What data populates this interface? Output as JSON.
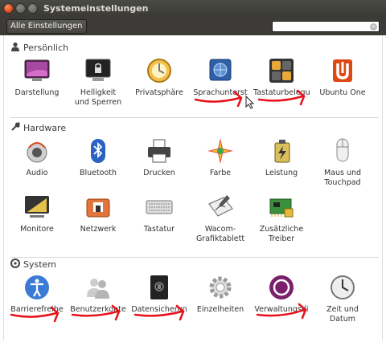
{
  "window": {
    "title": "Systemeinstellungen"
  },
  "toolbar": {
    "all_settings_label": "Alle Einstellungen",
    "search_value": "",
    "search_placeholder": ""
  },
  "sections": {
    "personal": {
      "title": "Persönlich",
      "items": [
        {
          "label": "Darstellung",
          "icon": "appearance-icon"
        },
        {
          "label": "Helligkeit\nund Sperren",
          "icon": "brightness-lock-icon"
        },
        {
          "label": "Privatsphäre",
          "icon": "privacy-icon"
        },
        {
          "label": "Sprachunterst",
          "icon": "language-support-icon"
        },
        {
          "label": "Tastaturbelegu",
          "icon": "keyboard-layout-icon"
        },
        {
          "label": "Ubuntu One",
          "icon": "ubuntu-one-icon"
        }
      ]
    },
    "hardware": {
      "title": "Hardware",
      "items": [
        {
          "label": "Audio",
          "icon": "audio-icon"
        },
        {
          "label": "Bluetooth",
          "icon": "bluetooth-icon"
        },
        {
          "label": "Drucken",
          "icon": "printer-icon"
        },
        {
          "label": "Farbe",
          "icon": "color-icon"
        },
        {
          "label": "Leistung",
          "icon": "power-icon"
        },
        {
          "label": "Maus und\nTouchpad",
          "icon": "mouse-icon"
        },
        {
          "label": "Monitore",
          "icon": "displays-icon"
        },
        {
          "label": "Netzwerk",
          "icon": "network-icon"
        },
        {
          "label": "Tastatur",
          "icon": "keyboard-icon"
        },
        {
          "label": "Wacom-\nGrafiktablett",
          "icon": "wacom-tablet-icon"
        },
        {
          "label": "Zusätzliche\nTreiber",
          "icon": "additional-drivers-icon"
        }
      ]
    },
    "system": {
      "title": "System",
      "items": [
        {
          "label": "Barrierefreihe",
          "icon": "accessibility-icon"
        },
        {
          "label": "Benutzerkonte",
          "icon": "user-accounts-icon"
        },
        {
          "label": "Datensicherun",
          "icon": "backup-icon"
        },
        {
          "label": "Einzelheiten",
          "icon": "details-icon"
        },
        {
          "label": "Verwaltungsdi",
          "icon": "management-service-icon"
        },
        {
          "label": "Zeit und\nDatum",
          "icon": "time-date-icon"
        }
      ]
    }
  },
  "colors": {
    "annotation": "#e8101b",
    "titlebar": "#3c3b37",
    "accent": "#dd4814"
  }
}
